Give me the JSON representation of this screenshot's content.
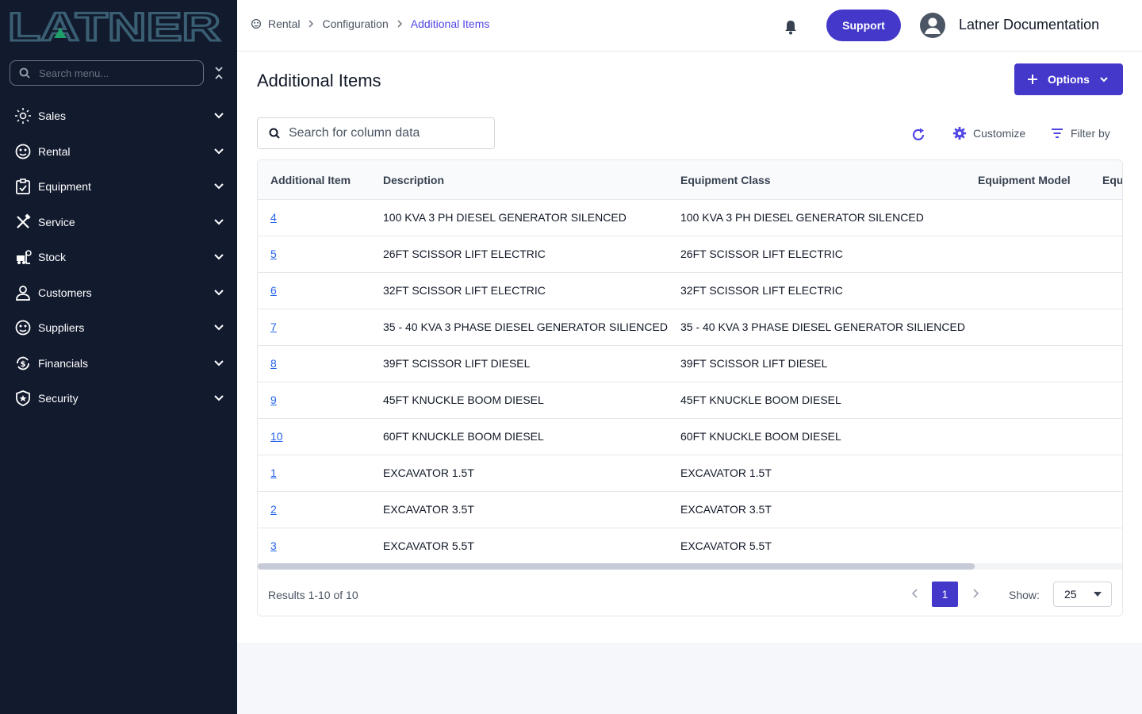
{
  "brand": {
    "logo_text": "LATNER"
  },
  "sidebar": {
    "search_placeholder": "Search menu...",
    "items": [
      {
        "label": "Sales",
        "icon": "sun-dashed-icon"
      },
      {
        "label": "Rental",
        "icon": "palette-icon"
      },
      {
        "label": "Equipment",
        "icon": "clipboard-icon"
      },
      {
        "label": "Service",
        "icon": "tools-icon"
      },
      {
        "label": "Stock",
        "icon": "forklift-icon"
      },
      {
        "label": "Customers",
        "icon": "user-icon"
      },
      {
        "label": "Suppliers",
        "icon": "palette-icon"
      },
      {
        "label": "Financials",
        "icon": "dollar-cycle-icon"
      },
      {
        "label": "Security",
        "icon": "shield-star-icon"
      }
    ]
  },
  "header": {
    "breadcrumb": [
      "Rental",
      "Configuration",
      "Additional Items"
    ],
    "support_label": "Support",
    "user_name": "Latner Documentation"
  },
  "main": {
    "title": "Additional Items",
    "options_label": "Options",
    "search_placeholder": "Search for column data",
    "customize_label": "Customize",
    "filter_label": "Filter by"
  },
  "table": {
    "columns": [
      "Additional Item",
      "Description",
      "Equipment Class",
      "Equipment Model",
      "Equ"
    ],
    "rows": [
      {
        "id": "4",
        "description": "100 KVA 3 PH DIESEL GENERATOR SILENCED",
        "class": "100 KVA 3 PH DIESEL GENERATOR SILENCED"
      },
      {
        "id": "5",
        "description": "26FT SCISSOR LIFT ELECTRIC",
        "class": "26FT SCISSOR LIFT ELECTRIC"
      },
      {
        "id": "6",
        "description": "32FT SCISSOR LIFT ELECTRIC",
        "class": "32FT SCISSOR LIFT ELECTRIC"
      },
      {
        "id": "7",
        "description": "35 - 40 KVA 3 PHASE DIESEL GENERATOR SILIENCED",
        "class": "35 - 40 KVA 3 PHASE DIESEL GENERATOR SILIENCED"
      },
      {
        "id": "8",
        "description": "39FT SCISSOR LIFT DIESEL",
        "class": "39FT SCISSOR LIFT DIESEL"
      },
      {
        "id": "9",
        "description": "45FT KNUCKLE BOOM DIESEL",
        "class": "45FT KNUCKLE BOOM DIESEL"
      },
      {
        "id": "10",
        "description": "60FT KNUCKLE BOOM DIESEL",
        "class": "60FT KNUCKLE BOOM DIESEL"
      },
      {
        "id": "1",
        "description": "EXCAVATOR 1.5T",
        "class": "EXCAVATOR 1.5T"
      },
      {
        "id": "2",
        "description": "EXCAVATOR 3.5T",
        "class": "EXCAVATOR 3.5T"
      },
      {
        "id": "3",
        "description": "EXCAVATOR 5.5T",
        "class": "EXCAVATOR 5.5T"
      }
    ]
  },
  "pagination": {
    "results_text": "Results 1-10 of 10",
    "current_page": "1",
    "show_label": "Show:",
    "page_size": "25"
  },
  "colors": {
    "sidebar_bg": "#121a2e",
    "accent": "#4338ca",
    "link": "#2563eb",
    "logo": "#3a5f73",
    "logo_accent": "#1f9f6a"
  }
}
